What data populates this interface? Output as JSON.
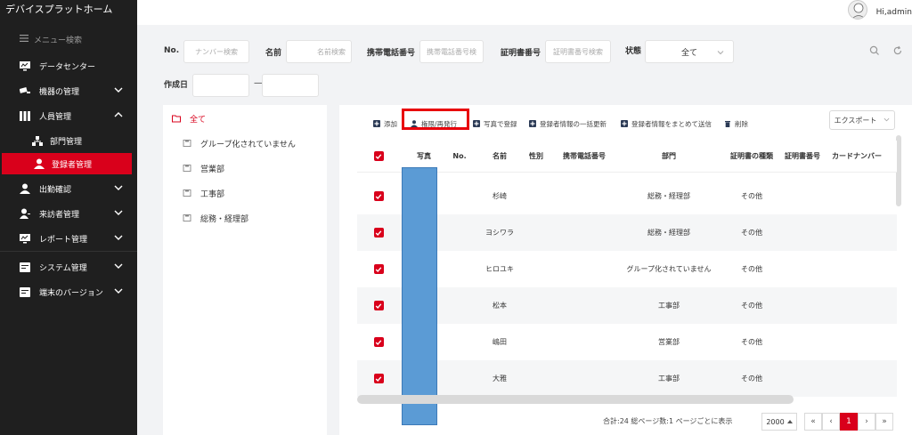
{
  "app": {
    "title": "デバイスプラットホーム",
    "greeting": "Hi,admin"
  },
  "sidebar": {
    "search_label": "メニュー検索",
    "items": [
      {
        "label": "データセンター",
        "icon": "monitor-icon",
        "expandable": false
      },
      {
        "label": "機器の管理",
        "icon": "camera-icon",
        "expandable": true,
        "expanded": false
      },
      {
        "label": "人員管理",
        "icon": "people-icon",
        "expandable": true,
        "expanded": true
      },
      {
        "label": "部門管理",
        "icon": "org-icon",
        "sub": true
      },
      {
        "label": "登録者管理",
        "icon": "user-icon",
        "sub": true,
        "active": true
      },
      {
        "label": "出勤確認",
        "icon": "user-icon",
        "expandable": true,
        "expanded": false
      },
      {
        "label": "来訪者管理",
        "icon": "visitor-icon",
        "expandable": true,
        "expanded": false
      },
      {
        "label": "レポート管理",
        "icon": "chart-icon",
        "expandable": true,
        "expanded": false
      },
      {
        "label": "システム管理",
        "icon": "system-icon",
        "expandable": true,
        "expanded": false
      },
      {
        "label": "端末のバージョン",
        "icon": "terminal-icon",
        "expandable": true,
        "expanded": false
      }
    ]
  },
  "filters": {
    "no_label": "No.",
    "no_placeholder": "ナンバー検索",
    "name_label": "名前",
    "name_placeholder": "名前検索",
    "phone_label": "携帯電話番号",
    "phone_placeholder": "携帯電話番号検",
    "cert_label": "証明書番号",
    "cert_placeholder": "証明書番号検索",
    "status_label": "状態",
    "status_value": "全て",
    "created_label": "作成日",
    "date_separator": "—"
  },
  "tree": {
    "root": "全て",
    "children": [
      "グループ化されていません",
      "営業部",
      "工事部",
      "総務・経理部"
    ]
  },
  "toolbar": {
    "add": "添加",
    "reissue": "権限/再発行",
    "photo_register": "写真で登録",
    "bulk_update": "登録者情報の一括更新",
    "bulk_send": "登録者情報をまとめて送信",
    "delete": "削除",
    "export": "エクスポート"
  },
  "table": {
    "columns": [
      "写真",
      "No.",
      "名前",
      "性別",
      "携帯電話番号",
      "部門",
      "証明書の種類",
      "証明書番号",
      "カードナンバー"
    ],
    "rows": [
      {
        "name": "杉崎",
        "dept": "総務・経理部",
        "cert_type": "その他"
      },
      {
        "name": "ヨシワラ",
        "dept": "総務・経理部",
        "cert_type": "その他"
      },
      {
        "name": "ヒロユキ",
        "dept": "グループ化されていません",
        "cert_type": "その他"
      },
      {
        "name": "松本",
        "dept": "工事部",
        "cert_type": "その他"
      },
      {
        "name": "嶋田",
        "dept": "営業部",
        "cert_type": "その他"
      },
      {
        "name": "大雅",
        "dept": "工事部",
        "cert_type": "その他"
      }
    ]
  },
  "pagination": {
    "summary": "合計:24 総ページ数:1 ページごとに表示",
    "page_size": "2000",
    "first": "«",
    "prev": "‹",
    "current": "1",
    "next": "›",
    "last": "»"
  },
  "colors": {
    "accent": "#d9001b",
    "sidebar_bg": "#1f1f1f",
    "photo_redaction": "#5b9bd5"
  }
}
